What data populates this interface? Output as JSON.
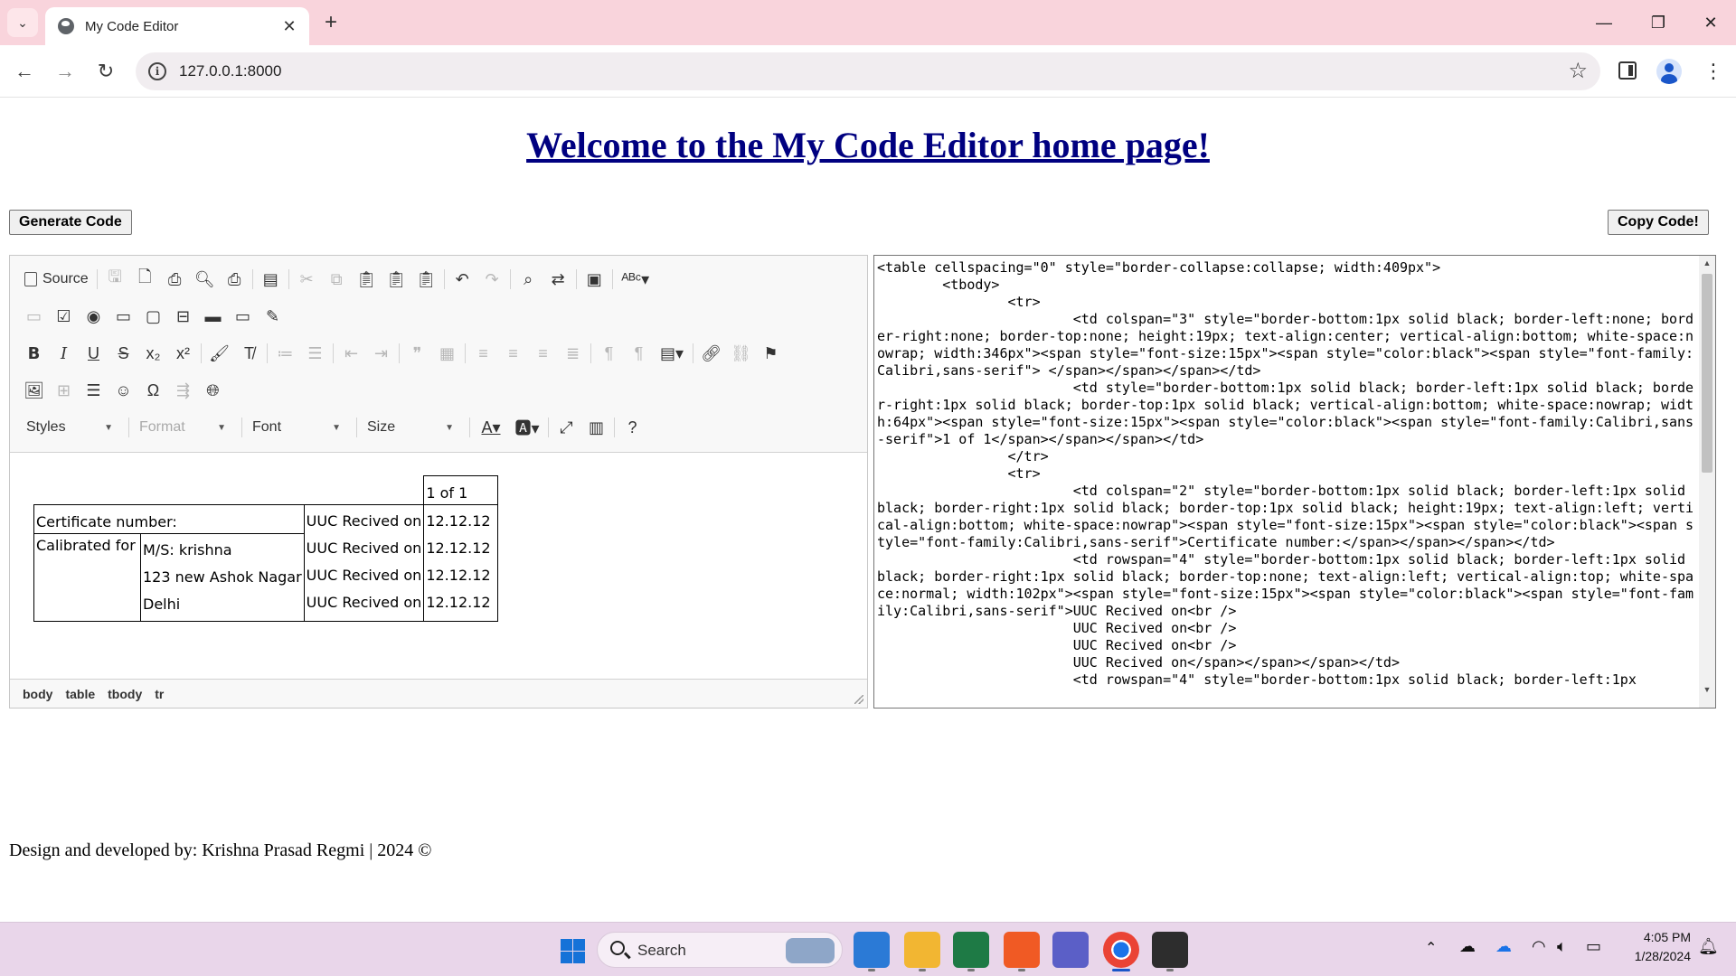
{
  "browser": {
    "tab_title": "My Code Editor",
    "url": "127.0.0.1:8000",
    "new_tab": "+",
    "tab_close": "✕"
  },
  "page": {
    "heading": "Welcome to the My Code Editor home page!",
    "generate_button": "Generate Code",
    "copy_button": "Copy Code!",
    "footer": "Design and developed by: Krishna Prasad Regmi | 2024 ©"
  },
  "editor": {
    "source_label": "Source",
    "combos": {
      "styles": "Styles",
      "format": "Format",
      "font": "Font",
      "size": "Size"
    },
    "breadcrumbs": [
      "body",
      "table",
      "tbody",
      "tr"
    ],
    "content": {
      "page_count": "1 of 1",
      "cert_label": "Certificate number:",
      "calibrated_label": "Calibrated for",
      "client_name": "M/S: krishna",
      "client_address": "123 new Ashok Nagar",
      "client_city": "Delhi",
      "uuc_label": "UUC Recived on",
      "uuc_date": "12.12.12"
    }
  },
  "code_output": "<table cellspacing=\"0\" style=\"border-collapse:collapse; width:409px\">\n\t<tbody>\n\t\t<tr>\n\t\t\t<td colspan=\"3\" style=\"border-bottom:1px solid black; border-left:none; border-right:none; border-top:none; height:19px; text-align:center; vertical-align:bottom; white-space:nowrap; width:346px\"><span style=\"font-size:15px\"><span style=\"color:black\"><span style=\"font-family:Calibri,sans-serif\"> </span></span></span></td>\n\t\t\t<td style=\"border-bottom:1px solid black; border-left:1px solid black; border-right:1px solid black; border-top:1px solid black; vertical-align:bottom; white-space:nowrap; width:64px\"><span style=\"font-size:15px\"><span style=\"color:black\"><span style=\"font-family:Calibri,sans-serif\">1 of 1</span></span></span></td>\n\t\t</tr>\n\t\t<tr>\n\t\t\t<td colspan=\"2\" style=\"border-bottom:1px solid black; border-left:1px solid black; border-right:1px solid black; border-top:1px solid black; height:19px; text-align:left; vertical-align:bottom; white-space:nowrap\"><span style=\"font-size:15px\"><span style=\"color:black\"><span style=\"font-family:Calibri,sans-serif\">Certificate number:</span></span></span></td>\n\t\t\t<td rowspan=\"4\" style=\"border-bottom:1px solid black; border-left:1px solid black; border-right:1px solid black; border-top:none; text-align:left; vertical-align:top; white-space:normal; width:102px\"><span style=\"font-size:15px\"><span style=\"color:black\"><span style=\"font-family:Calibri,sans-serif\">UUC Recived on<br />\n\t\t\tUUC Recived on<br />\n\t\t\tUUC Recived on<br />\n\t\t\tUUC Recived on</span></span></span></td>\n\t\t\t<td rowspan=\"4\" style=\"border-bottom:1px solid black; border-left:1px",
  "taskbar": {
    "search_label": "Search",
    "time": "4:05 PM",
    "date": "1/28/2024"
  },
  "colors": {
    "tabstrip": "#f9d4dc",
    "heading_link": "#000080",
    "taskbar": "#e9d6ea"
  }
}
